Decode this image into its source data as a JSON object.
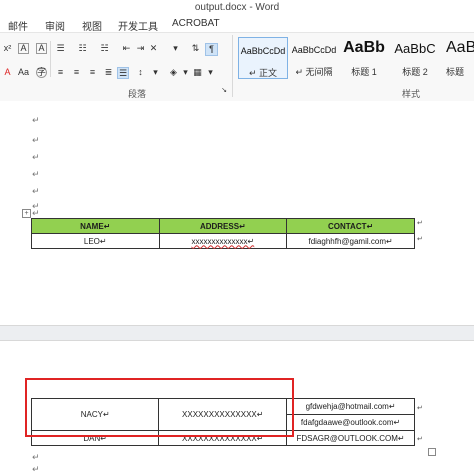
{
  "window": {
    "title": "output.docx - Word"
  },
  "menu_tabs": [
    "邮件",
    "审阅",
    "视图",
    "开发工具",
    "ACROBAT"
  ],
  "ribbon": {
    "paragraph_group_label": "段落",
    "styles_group_label": "样式",
    "styles": [
      {
        "preview": "AaBbCcDd",
        "name": "↵ 正文"
      },
      {
        "preview": "AaBbCcDd",
        "name": "↵ 无间隔"
      },
      {
        "preview": "AaBb",
        "name": "标题 1"
      },
      {
        "preview": "AaBbC",
        "name": "标题 2"
      },
      {
        "preview": "AaBb",
        "name": "标题"
      }
    ]
  },
  "document": {
    "paragraph_mark": "↵",
    "table1": {
      "headers": [
        "NAME↵",
        "ADDRESS↵",
        "CONTACT↵"
      ],
      "rows": [
        [
          "LEO↵",
          "xxxxxxxxxxxxxx↵",
          "fdiaghhfh@gamil.com↵"
        ]
      ]
    },
    "table2": {
      "rows": [
        [
          "NACY↵",
          "XXXXXXXXXXXXXX↵",
          "gfdwehja@hotmail.com↵",
          "fdafgdaawe@outlook.com↵"
        ],
        [
          "DAN↵",
          "XXXXXXXXXXXXXX↵",
          "FDSAGR@OUTLOOK.COM↵"
        ]
      ]
    },
    "table_header_color": "#92d050",
    "highlight_color": "#e02424"
  }
}
